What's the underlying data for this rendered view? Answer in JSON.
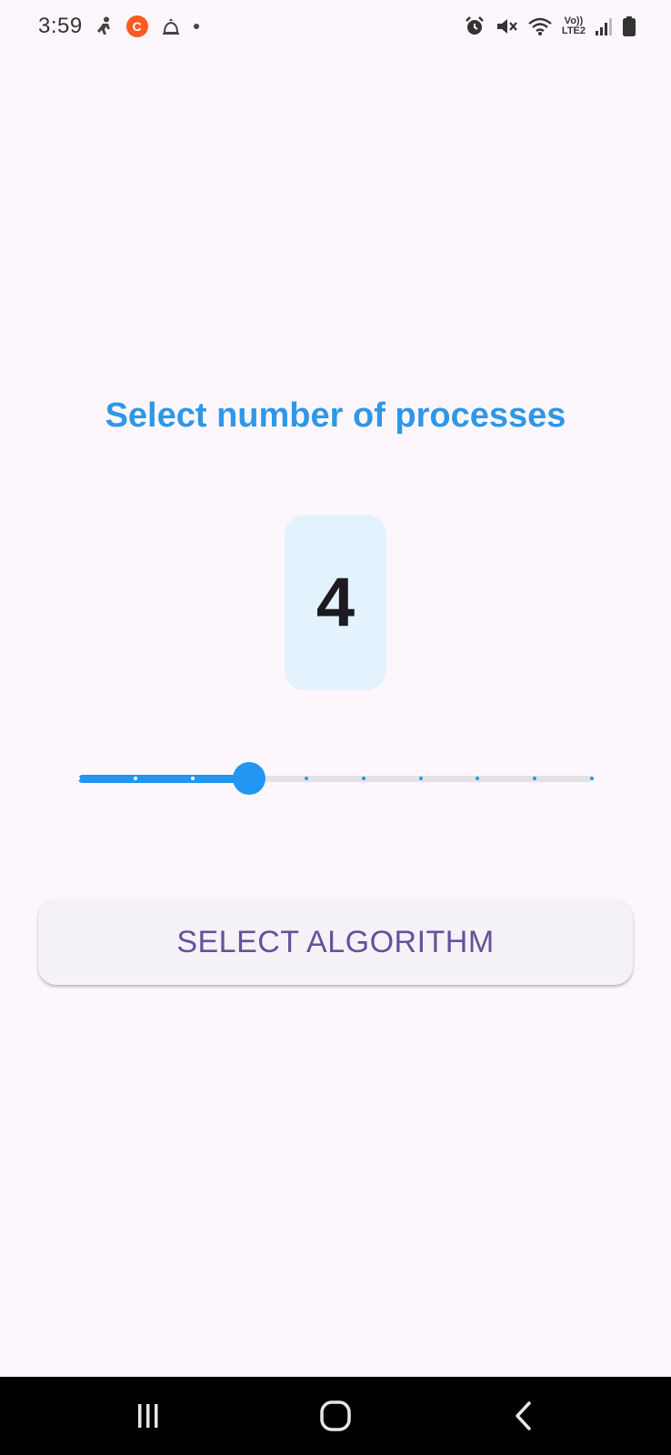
{
  "status_bar": {
    "time": "3:59",
    "left_icons": [
      "run-activity-icon",
      "camera-app-badge-icon",
      "bell-notification-icon",
      "more-dot-icon"
    ],
    "right_icons": [
      "alarm-icon",
      "mute-icon",
      "wifi-icon",
      "volte-lte2-icon",
      "signal-icon",
      "battery-icon"
    ],
    "network_label_top": "Vo))",
    "network_label_bottom": "LTE2"
  },
  "main": {
    "title": "Select number of processes",
    "count_value": "4",
    "slider": {
      "min": 1,
      "max": 10,
      "value": 4,
      "active_color": "#2196f3",
      "inactive_color": "#e2e2e2"
    },
    "select_button_label": "SELECT ALGORITHM"
  },
  "colors": {
    "title": "#2f97e6",
    "background": "#fdf7fd",
    "count_box": "#e3f2fd",
    "button_text": "#65519e",
    "button_bg": "#f5f2f7"
  },
  "nav_bar": {
    "items": [
      "recent-apps-icon",
      "home-icon",
      "back-icon"
    ]
  }
}
